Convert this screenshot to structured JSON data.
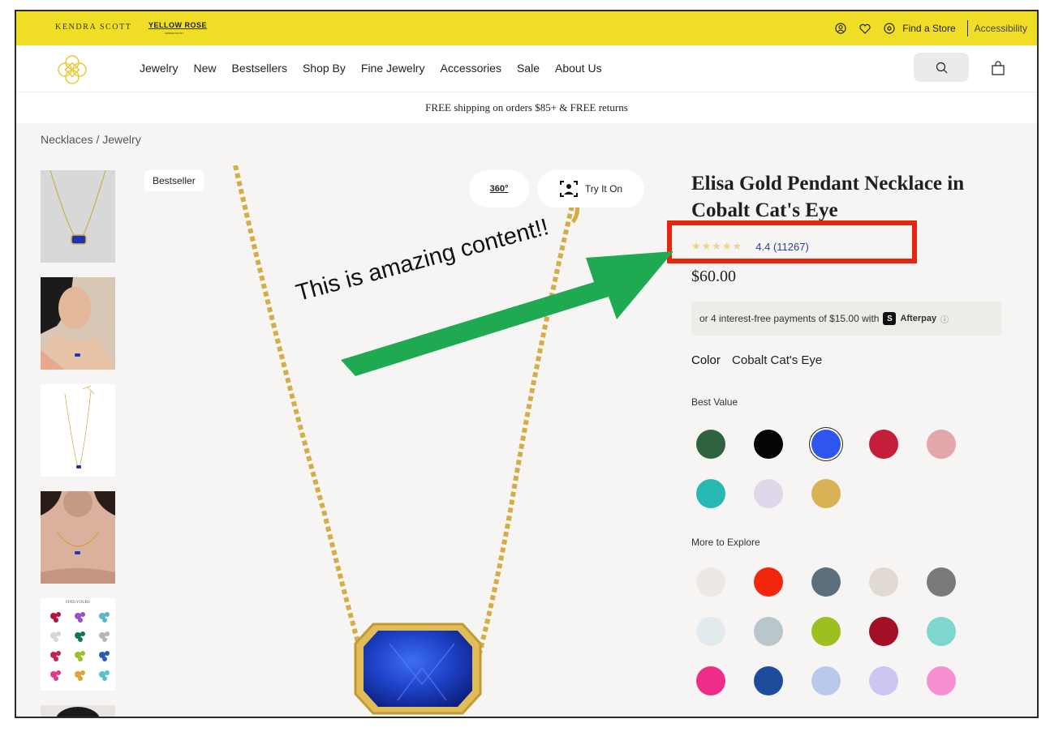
{
  "topbar": {
    "brand_primary": "KENDRA SCOTT",
    "brand_secondary": "YELLOW ROSE",
    "brand_secondary_sub": "KENDRA SCOTT",
    "find_store": "Find a Store",
    "accessibility": "Accessibility",
    "bg_color": "#f0dd26"
  },
  "nav": {
    "items": [
      "Jewelry",
      "New",
      "Bestsellers",
      "Shop By",
      "Fine Jewelry",
      "Accessories",
      "Sale",
      "About Us"
    ]
  },
  "promo": "FREE shipping on orders $85+ & FREE returns",
  "breadcrumb": "Necklaces  /  Jewelry",
  "gallery": {
    "badge": "Bestseller",
    "view360": "360°",
    "try_on": "Try It On",
    "thumb5_caption": "FIND YOURS"
  },
  "product": {
    "title": "Elisa Gold Pendant Necklace in Cobalt Cat's Eye",
    "stars": "★★★★★",
    "rating_text": "4.4 (11267)",
    "rating": 4.4,
    "review_count": 11267,
    "price": "$60.00",
    "afterpay_text": "or 4 interest-free payments of $15.00 with",
    "afterpay_brand": "Afterpay",
    "afterpay_info": "ⓘ",
    "color_label": "Color",
    "color_value": "Cobalt Cat's Eye"
  },
  "sections": {
    "best_value": "Best Value",
    "more_to_explore": "More to Explore"
  },
  "swatches": {
    "best_value": [
      {
        "name": "green",
        "color": "#2f6340"
      },
      {
        "name": "black",
        "color": "#050505"
      },
      {
        "name": "cobalt",
        "color": "#2f55ef",
        "selected": true
      },
      {
        "name": "red",
        "color": "#c41e3a"
      },
      {
        "name": "rose",
        "color": "#e3a6a9"
      },
      {
        "name": "teal",
        "color": "#27b8b4"
      },
      {
        "name": "lilac",
        "color": "#e0d7ea"
      },
      {
        "name": "gold",
        "color": "#d9b255"
      }
    ],
    "more": [
      {
        "name": "white-pearl",
        "color": "#ece9e5"
      },
      {
        "name": "orange-red",
        "color": "#f2260a"
      },
      {
        "name": "abalone",
        "color": "#5b6f7d"
      },
      {
        "name": "drusy",
        "color": "#e1dad3"
      },
      {
        "name": "silver-drusy",
        "color": "#7a7a7a"
      },
      {
        "name": "light-blue",
        "color": "#e3eaed"
      },
      {
        "name": "grey-blue",
        "color": "#b9c6cc"
      },
      {
        "name": "lime",
        "color": "#9dbf22"
      },
      {
        "name": "glitter-red",
        "color": "#a30f24"
      },
      {
        "name": "aqua-stripe",
        "color": "#7fd6cf"
      },
      {
        "name": "hot-pink",
        "color": "#ef2c8a"
      },
      {
        "name": "navy",
        "color": "#1c4c9b"
      },
      {
        "name": "stars",
        "color": "#b9c9ec"
      },
      {
        "name": "opal",
        "color": "#cbc6f2"
      },
      {
        "name": "pink",
        "color": "#f78fd0"
      }
    ]
  },
  "annotation": {
    "text": "This is amazing content!!",
    "arrow_color": "#1faa52",
    "box_color": "#e8250f"
  }
}
